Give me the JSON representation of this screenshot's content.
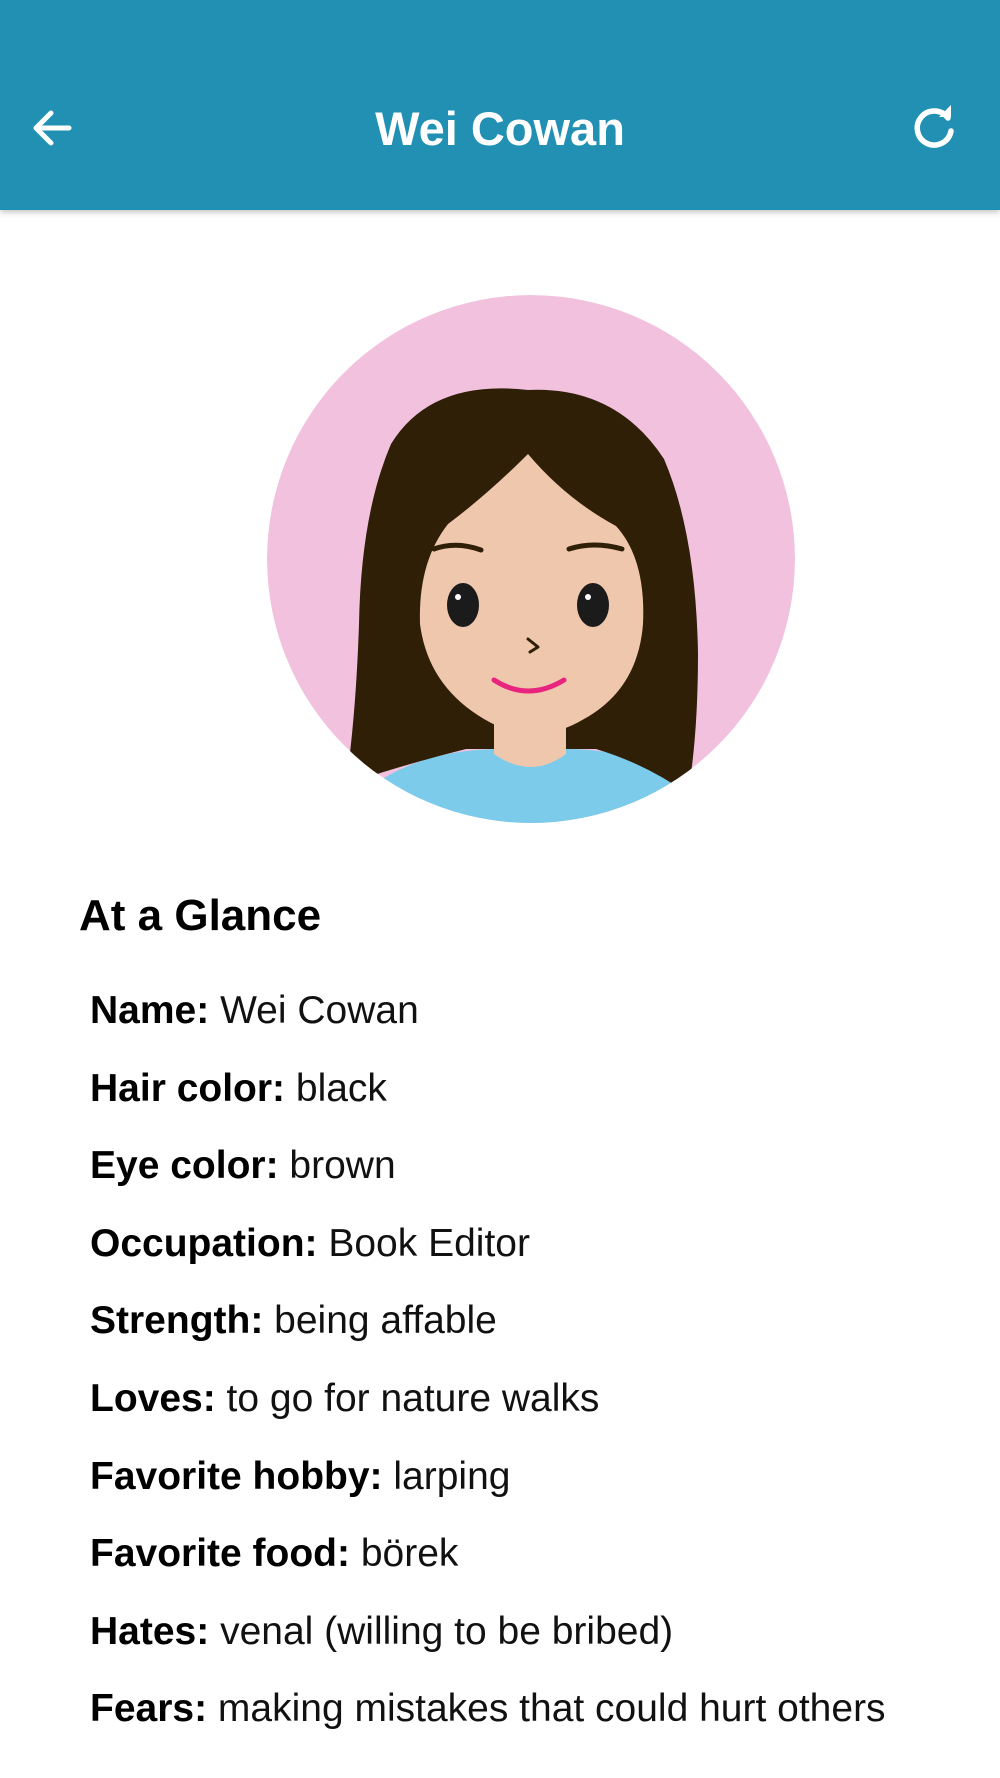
{
  "header": {
    "title": "Wei Cowan",
    "back_icon": "arrow-left-icon",
    "refresh_icon": "refresh-icon",
    "background_color": "#2190b3"
  },
  "avatar": {
    "icon": "avatar-illustration",
    "background_color": "#f2c1de",
    "hair_color": "#2e1f06",
    "skin_color": "#efc7ad",
    "shirt_color": "#7ccbeb"
  },
  "glance": {
    "heading": "At a Glance",
    "items": [
      {
        "label": "Name:",
        "value": "Wei Cowan"
      },
      {
        "label": "Hair color:",
        "value": "black"
      },
      {
        "label": "Eye color:",
        "value": "brown"
      },
      {
        "label": "Occupation:",
        "value": "Book Editor"
      },
      {
        "label": "Strength:",
        "value": "being affable"
      },
      {
        "label": "Loves:",
        "value": "to go for nature walks"
      },
      {
        "label": "Favorite hobby:",
        "value": "larping"
      },
      {
        "label": "Favorite food:",
        "value": "börek"
      },
      {
        "label": "Hates:",
        "value": "venal (willing to be bribed)"
      },
      {
        "label": "Fears:",
        "value": "making mistakes that could hurt others"
      }
    ]
  }
}
